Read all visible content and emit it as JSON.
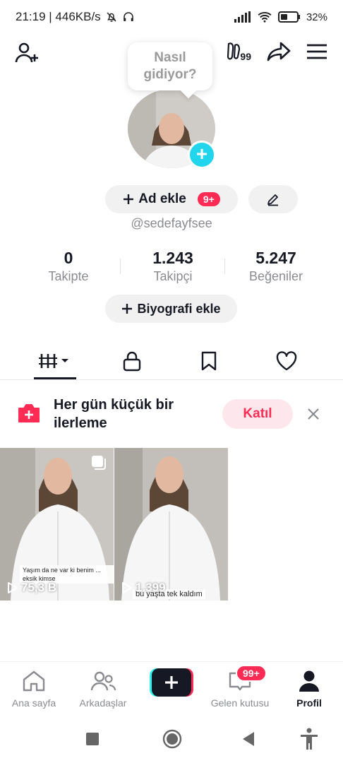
{
  "status_bar": {
    "time_speed": "21:19 | 446KB/s",
    "battery": "32%",
    "icons": [
      "mute-bell-icon",
      "headphones-icon",
      "signal-icon",
      "wifi-icon",
      "battery-icon"
    ]
  },
  "profile": {
    "bubble_line1": "Nasıl",
    "bubble_line2": "gidiyor?",
    "add_name_label": "Ad ekle",
    "add_name_badge": "9+",
    "username": "@sedefayfsee",
    "top_right_badge": "99",
    "stats": [
      {
        "value": "0",
        "label": "Takipte"
      },
      {
        "value": "1.243",
        "label": "Takipçi"
      },
      {
        "value": "5.247",
        "label": "Beğeniler"
      }
    ],
    "bio_label": "Biyografi ekle"
  },
  "promo": {
    "text": "Her gün küçük bir ilerleme",
    "join_label": "Katıl"
  },
  "videos": [
    {
      "caption": "Yaşım da ne var ki benim ... eksik kimse",
      "views": "75,3 B"
    },
    {
      "caption": "bu yaşta tek kaldım",
      "views": "1.399"
    }
  ],
  "bottom_nav": {
    "home": "Ana sayfa",
    "friends": "Arkadaşlar",
    "inbox": "Gelen kutusu",
    "inbox_badge": "99+",
    "profile": "Profil"
  },
  "colors": {
    "accent_red": "#fe2c55",
    "accent_cyan": "#20d5ec",
    "text_primary": "#161823",
    "text_secondary": "#8a8b91"
  }
}
